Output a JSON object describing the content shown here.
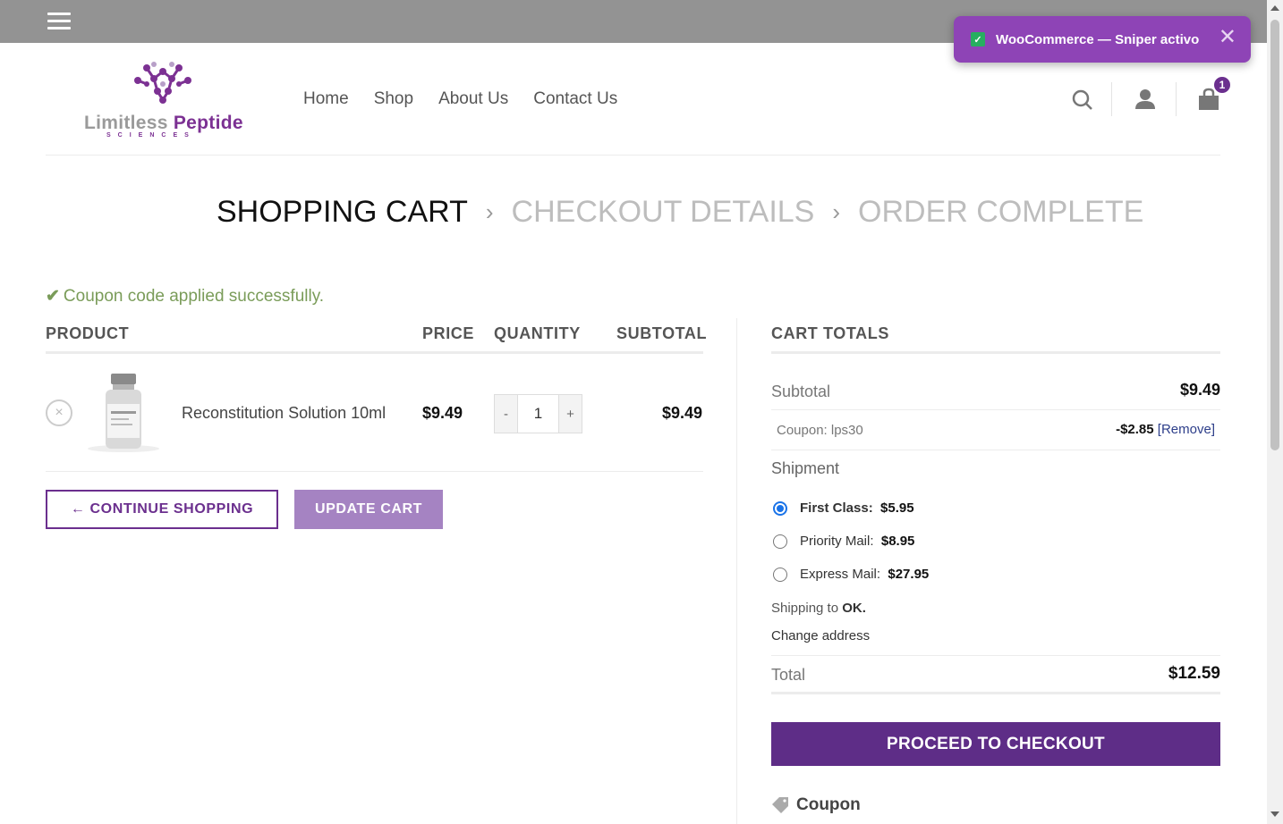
{
  "notification": {
    "text": "WooCommerce — Sniper activo",
    "close": "✕"
  },
  "brand": {
    "name_part1": "Limitless",
    "name_part2": "Peptide",
    "tagline": "SCIENCES"
  },
  "nav": {
    "items": [
      "Home",
      "Shop",
      "About Us",
      "Contact Us"
    ]
  },
  "header": {
    "cart_count": "1"
  },
  "steps": {
    "step1": "SHOPPING CART",
    "step2": "CHECKOUT DETAILS",
    "step3": "ORDER COMPLETE",
    "separator": "›"
  },
  "notice": {
    "icon": "✔",
    "text": "Coupon code applied successfully."
  },
  "cart_table": {
    "headers": {
      "product": "PRODUCT",
      "price": "PRICE",
      "quantity": "QUANTITY",
      "subtotal": "SUBTOTAL"
    },
    "items": [
      {
        "name": "Reconstitution Solution 10ml",
        "price": "$9.49",
        "quantity": "1",
        "subtotal": "$9.49",
        "remove": "×",
        "minus": "-",
        "plus": "+"
      }
    ]
  },
  "actions": {
    "continue": "← CONTINUE SHOPPING",
    "update": "UPDATE CART"
  },
  "totals": {
    "title": "CART TOTALS",
    "subtotal_label": "Subtotal",
    "subtotal_value": "$9.49",
    "coupon_label": "Coupon: lps30",
    "coupon_value": "-$2.85",
    "coupon_remove": "[Remove]",
    "shipment_label": "Shipment",
    "shipping_options": [
      {
        "label": "First Class:",
        "price": "$5.95",
        "selected": true
      },
      {
        "label": "Priority Mail:",
        "price": "$8.95",
        "selected": false
      },
      {
        "label": "Express Mail:",
        "price": "$27.95",
        "selected": false
      }
    ],
    "shipping_to_prefix": "Shipping to",
    "shipping_to_state": "OK.",
    "change_address": "Change address",
    "total_label": "Total",
    "total_value": "$12.59",
    "checkout_button": "PROCEED TO CHECKOUT",
    "coupon_section": "Coupon"
  },
  "colors": {
    "brand_purple": "#6b2f8e",
    "checkout_purple": "#5e2d87",
    "toast_purple": "#8e44b6",
    "success_green": "#7a9c59"
  }
}
